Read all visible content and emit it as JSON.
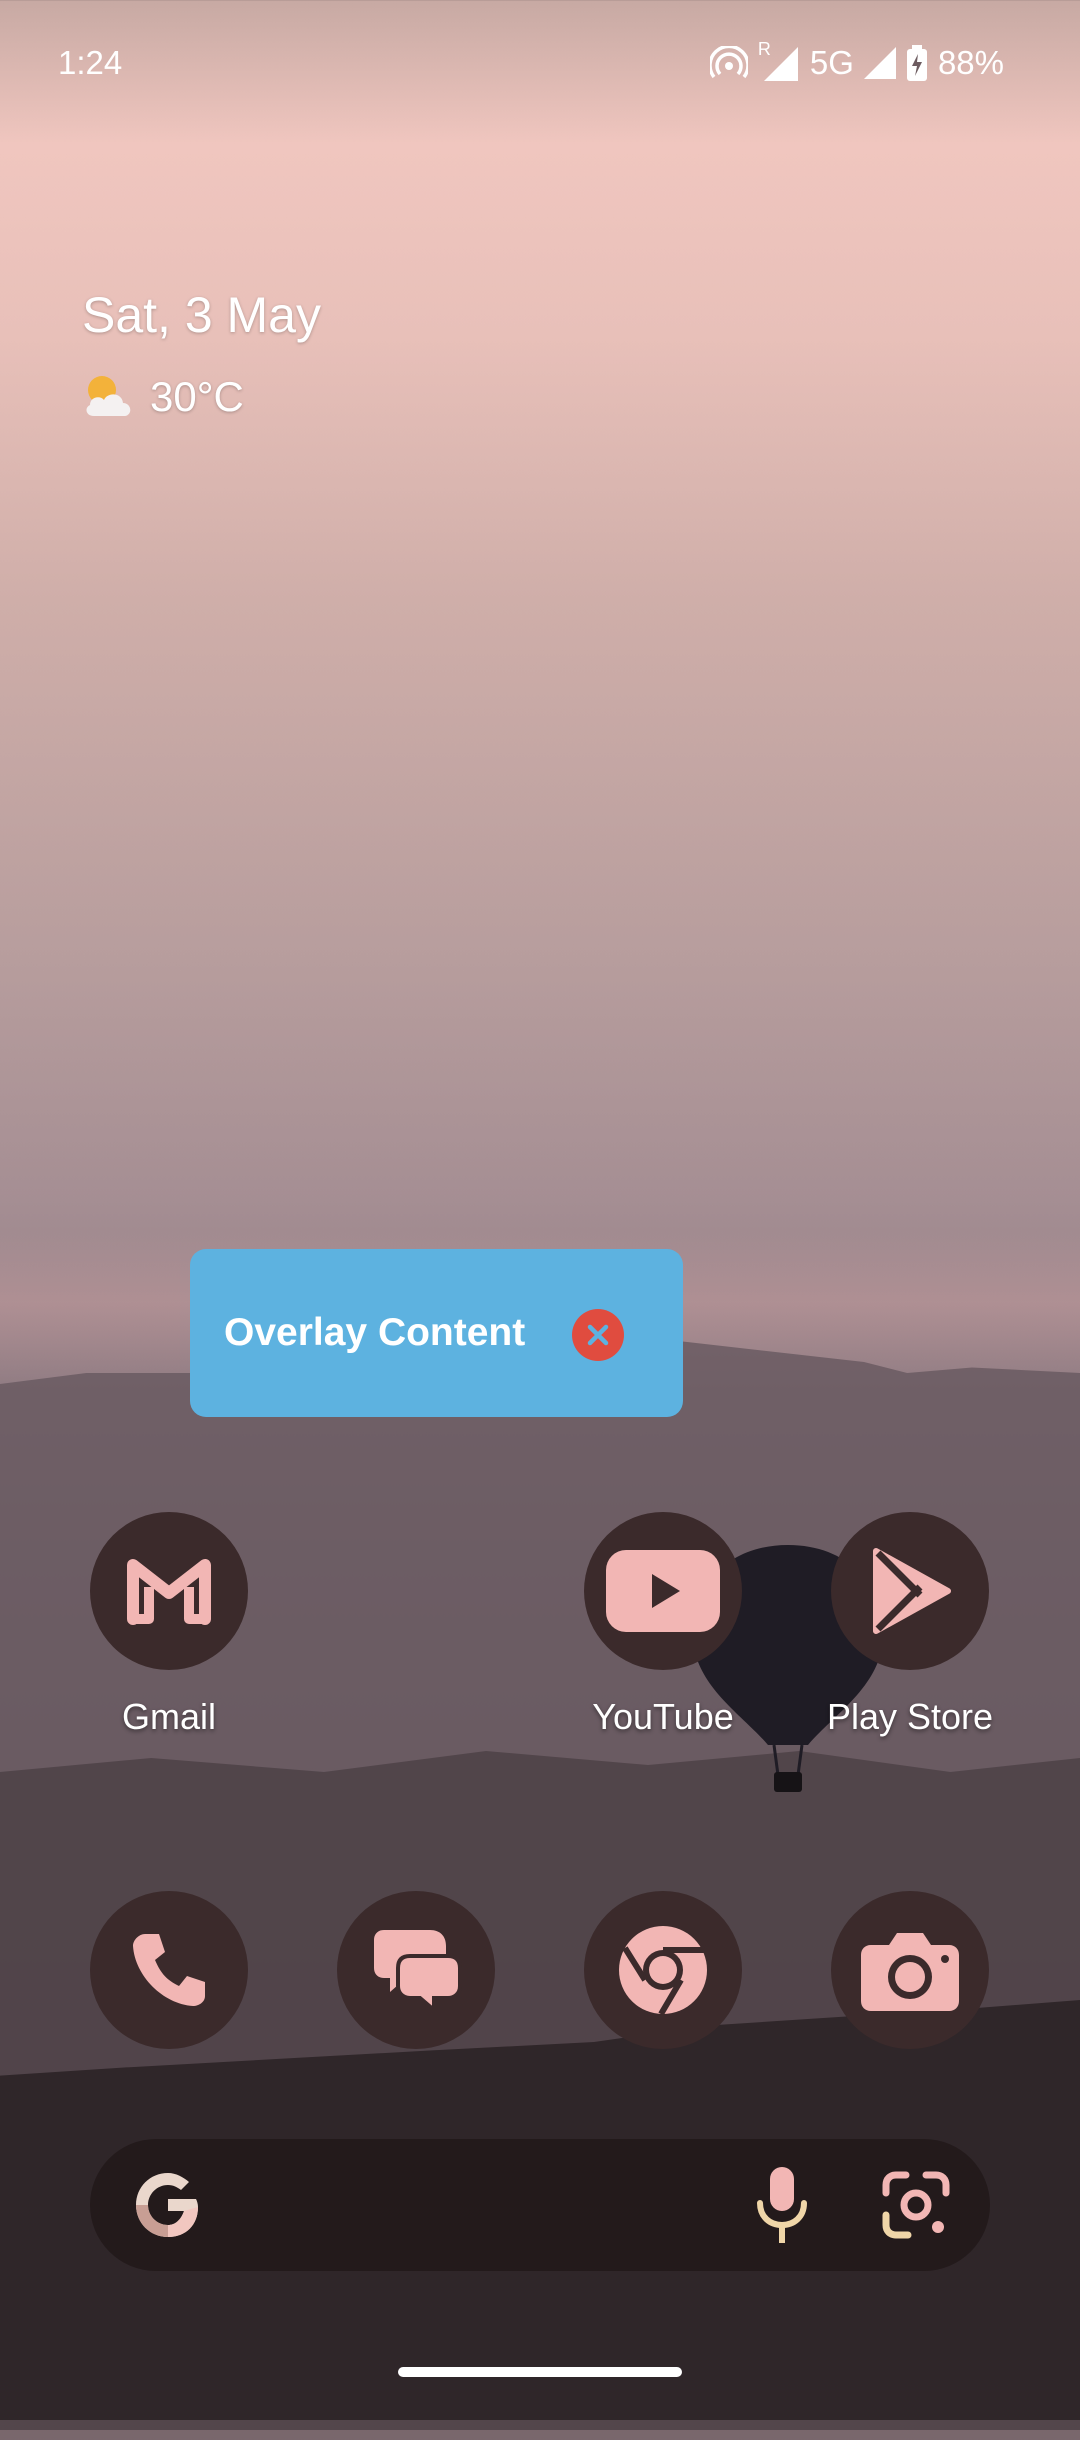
{
  "status_bar": {
    "time": "1:24",
    "roaming": "R",
    "network": "5G",
    "battery": "88%"
  },
  "widget": {
    "date": "Sat, 3 May",
    "temperature": "30°C",
    "weather_icon": "partly-cloudy-icon"
  },
  "overlay": {
    "label": "Overlay Content",
    "close_icon": "close-icon"
  },
  "apps_row": [
    {
      "label": "Gmail",
      "icon": "gmail-icon"
    },
    {
      "label": "YouTube",
      "icon": "youtube-icon"
    },
    {
      "label": "Play Store",
      "icon": "play-store-icon"
    }
  ],
  "dock": [
    {
      "icon": "phone-icon"
    },
    {
      "icon": "messages-icon"
    },
    {
      "icon": "chrome-icon"
    },
    {
      "icon": "camera-icon"
    }
  ],
  "search_bar": {
    "logo": "google-g-icon",
    "voice": "mic-icon",
    "lens": "lens-icon"
  },
  "colors": {
    "icon_fg": "#f2b6b4",
    "icon_bg": "#3b2a2b",
    "overlay_bg": "#5db2e0",
    "overlay_close": "#e04c3f"
  }
}
